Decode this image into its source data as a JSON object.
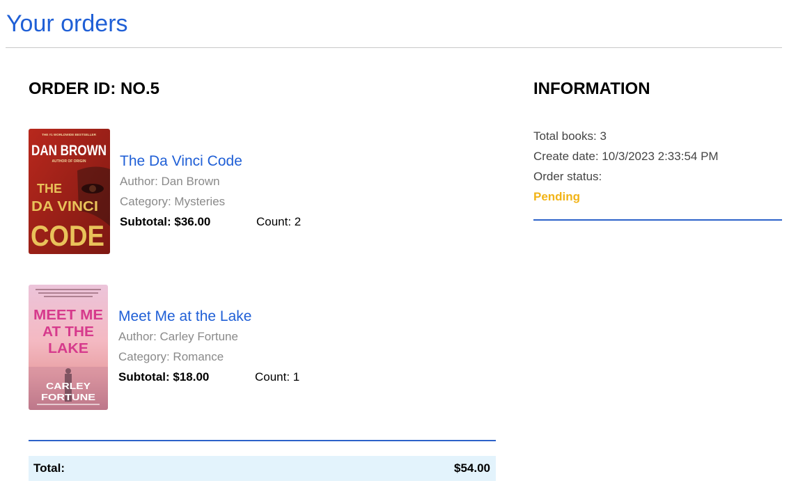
{
  "page": {
    "title": "Your orders"
  },
  "order": {
    "heading": "ORDER ID: NO.5",
    "items": [
      {
        "title": "The Da Vinci Code",
        "author": "Author: Dan Brown",
        "category": "Category: Mysteries",
        "subtotal": "Subtotal: $36.00",
        "count": "Count: 2",
        "cover": {
          "top_text": "THE #1 WORLDWIDE BESTSELLER",
          "author_name": "DAN BROWN",
          "subtitle": "AUTHOR OF ORIGIN",
          "line1": "THE",
          "line2": "DA VINCI",
          "line3": "CODE",
          "colors": {
            "bg": "#a3251c",
            "text": "#e9c25a",
            "author": "#ffffff"
          }
        }
      },
      {
        "title": "Meet Me at the Lake",
        "author": "Author: Carley Fortune",
        "category": "Category: Romance",
        "subtotal": "Subtotal: $18.00",
        "count": "Count: 1",
        "cover": {
          "line1": "MEET ME",
          "line2": "AT THE",
          "line3": "LAKE",
          "author_first": "CARLEY",
          "author_last": "FORTUNE",
          "colors": {
            "sky": "#f1b6c8",
            "title": "#d63a8c",
            "author": "#ffffff"
          }
        }
      }
    ],
    "total_label": "Total:",
    "total_value": "$54.00"
  },
  "information": {
    "heading": "INFORMATION",
    "total_books": "Total books: 3",
    "create_date": "Create date: 10/3/2023 2:33:54 PM",
    "status_label": "Order status:",
    "status_value": "Pending"
  },
  "colors": {
    "accent": "#1f5fd6",
    "rule": "#2c62c9",
    "pending": "#f2b417",
    "total_bg": "#e3f3fc"
  }
}
